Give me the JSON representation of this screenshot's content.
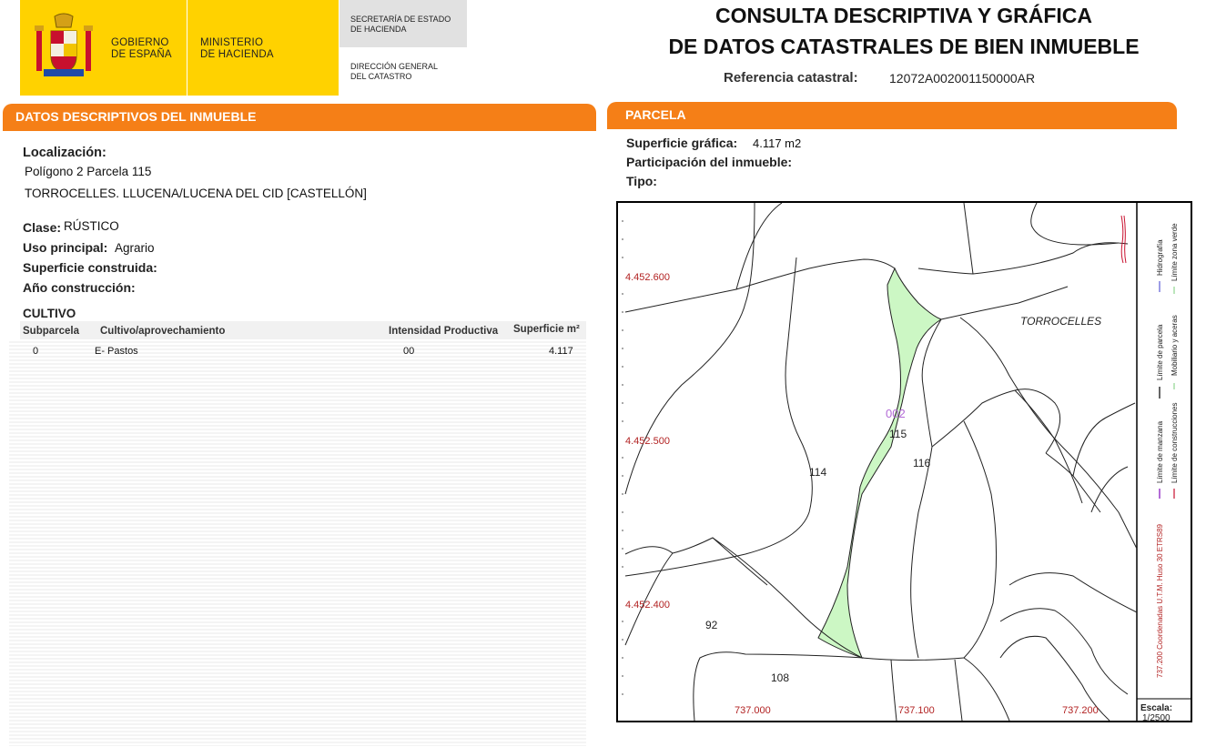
{
  "header": {
    "gobierno": [
      "GOBIERNO",
      "DE ESPAÑA"
    ],
    "ministerio": [
      "MINISTERIO",
      "DE HACIENDA"
    ],
    "secretaria": [
      "SECRETARÍA DE ESTADO",
      "DE HACIENDA"
    ],
    "direccion": [
      "DIRECCIÓN GENERAL",
      "DEL CATASTRO"
    ],
    "title_line1": "CONSULTA DESCRIPTIVA Y GRÁFICA",
    "title_line2": "DE DATOS CATASTRALES DE BIEN INMUEBLE",
    "ref_label": "Referencia catastral:",
    "ref_value": "12072A002001150000AR"
  },
  "datos": {
    "section_title": "DATOS DESCRIPTIVOS DEL INMUEBLE",
    "localizacion_label": "Localización:",
    "localizacion_line1": "Polígono 2 Parcela 115",
    "localizacion_line2": "TORROCELLES. LLUCENA/LUCENA DEL CID [CASTELLÓN]",
    "clase_label": "Clase:",
    "clase_value": "RÚSTICO",
    "uso_label": "Uso principal:",
    "uso_value": "Agrario",
    "superficie_construida_label": "Superficie construida:",
    "anio_label": "Año construcción:",
    "cultivo_title": "CULTIVO",
    "table_headers": [
      "Subparcela",
      "Cultivo/aprovechamiento",
      "Intensidad Productiva",
      "Superficie m²"
    ],
    "table_rows": [
      [
        "0",
        "E- Pastos",
        "00",
        "4.117"
      ]
    ]
  },
  "parcela": {
    "section_title": "PARCELA",
    "superficie_label": "Superficie gráfica:",
    "superficie_value": "4.117 m2",
    "participacion_label": "Participación del inmueble:",
    "tipo_label": "Tipo:"
  },
  "map": {
    "coords_y": [
      "4.452.600",
      "4.452.500",
      "4.452.400"
    ],
    "coords_x": [
      "737.000",
      "737.100",
      "737.200"
    ],
    "parcel_labels": [
      "114",
      "115",
      "116",
      "92",
      "108",
      "002"
    ],
    "place_label": "TORROCELLES",
    "legend": {
      "limite_parcela": "Límite de parcela",
      "hidrografia": "Hidrografía",
      "mobiliario": "Mobiliario y aceras",
      "limite_zona_verde": "Límite zona verde",
      "limite_manzana": "Límite de manzana",
      "limite_construcciones": "Límite de construcciones",
      "coords_note": "737.200 Coordenadas U.T.M. Huso 30 ETRS89"
    },
    "scale_label": "Escala:",
    "scale_value": "1/2500",
    "colors": {
      "parcel_fill": "#ccf7c4",
      "coord_text": "#b22222",
      "header_orange": "#f57f17"
    }
  }
}
